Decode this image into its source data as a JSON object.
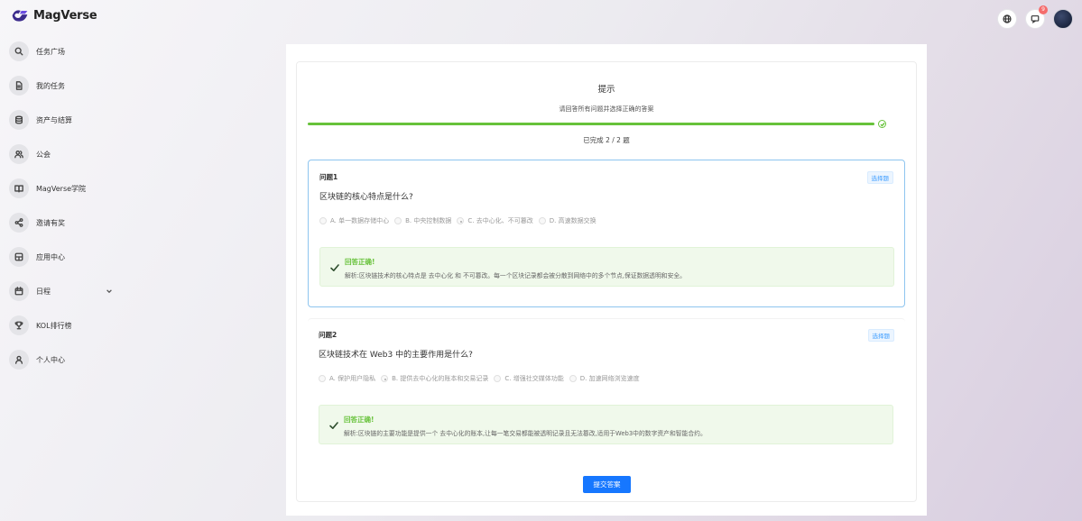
{
  "brand": {
    "name": "MagVerse"
  },
  "sidebar": {
    "items": [
      {
        "label": "任务广场",
        "icon": "search-icon"
      },
      {
        "label": "我的任务",
        "icon": "document-icon"
      },
      {
        "label": "资产与结算",
        "icon": "database-icon"
      },
      {
        "label": "公会",
        "icon": "users-icon"
      },
      {
        "label": "MagVerse学院",
        "icon": "book-icon"
      },
      {
        "label": "邀请有奖",
        "icon": "share-icon"
      },
      {
        "label": "应用中心",
        "icon": "app-icon"
      },
      {
        "label": "日程",
        "icon": "calendar-icon"
      },
      {
        "label": "KOL排行榜",
        "icon": "trophy-icon"
      },
      {
        "label": "个人中心",
        "icon": "user-icon"
      }
    ]
  },
  "header": {
    "notification_count": "9"
  },
  "quiz": {
    "title": "提示",
    "subtitle": "请回答所有问题并选择正确的答案",
    "progress_text": "已完成 2 / 2 题",
    "progress_fraction": 1.0,
    "questions": [
      {
        "label": "问题1",
        "tag": "选择题",
        "text": "区块链的核心特点是什么?",
        "options": [
          "A. 单一数据存储中心",
          "B. 中央控制数据",
          "C. 去中心化、不可篡改",
          "D. 高速数据交换"
        ],
        "selected": 2,
        "result_title": "回答正确!",
        "explanation": "解析:区块链技术的核心特点是 去中心化 和 不可篡改。每一个区块记录都会被分散到网络中的多个节点,保证数据透明和安全。"
      },
      {
        "label": "问题2",
        "tag": "选择题",
        "text": "区块链技术在 Web3 中的主要作用是什么?",
        "options": [
          "A. 保护用户隐私",
          "B. 提供去中心化的账本和交易记录",
          "C. 增强社交媒体功能",
          "D. 加速网络浏览速度"
        ],
        "selected": 1,
        "result_title": "回答正确!",
        "explanation": "解析:区块链的主要功能是提供一个 去中心化的账本,让每一笔交易都能被透明记录且无法篡改,适用于Web3中的数字资产和智能合约。"
      }
    ],
    "submit_label": "提交答案"
  }
}
